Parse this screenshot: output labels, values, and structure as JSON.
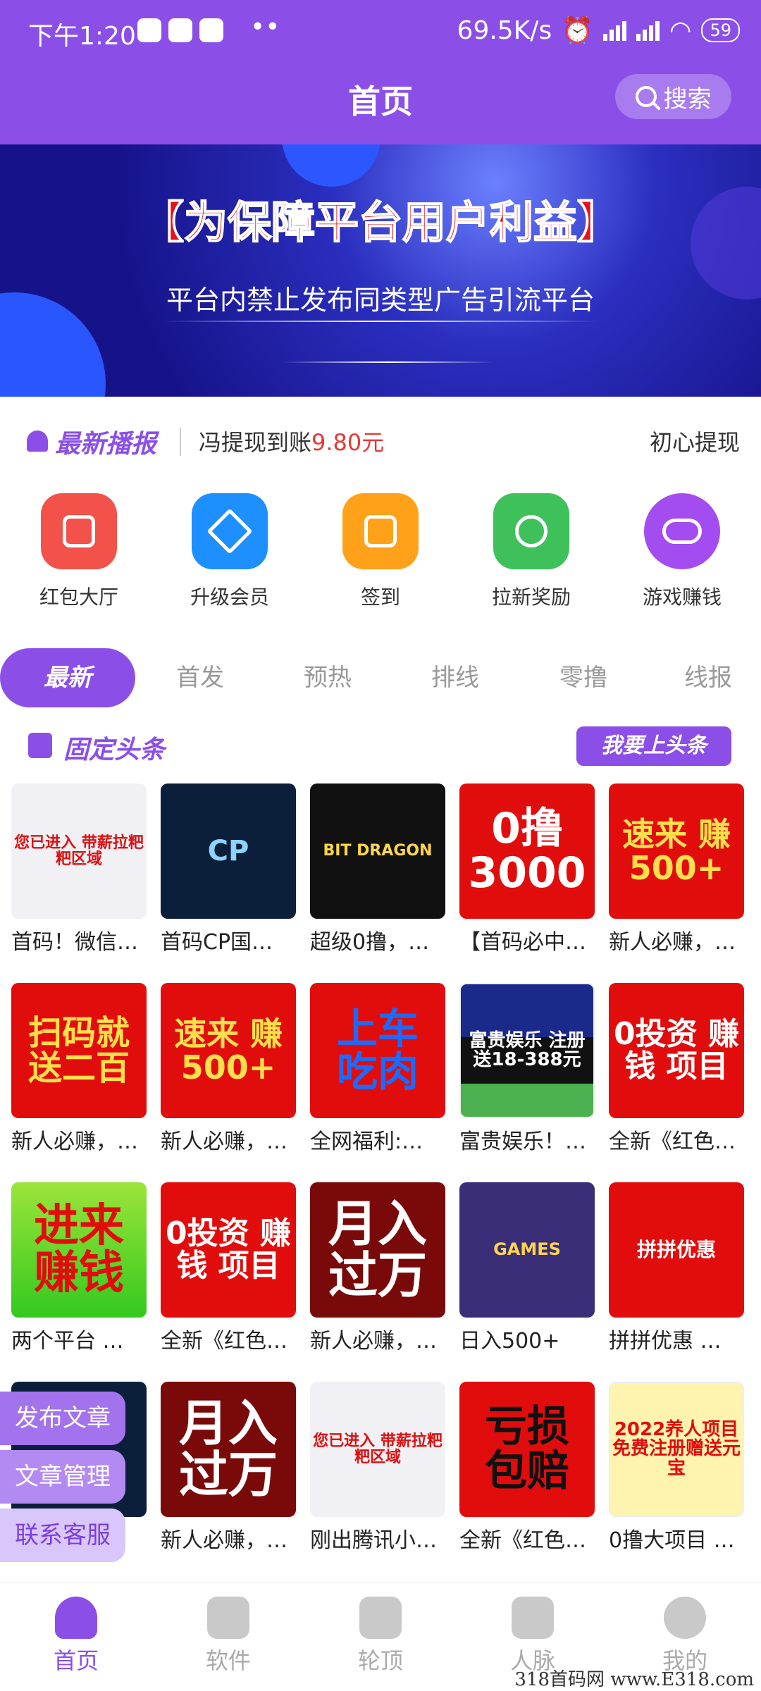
{
  "status": {
    "time": "下午1:20",
    "dots": "••",
    "network_speed": "69.5K/s",
    "battery": "59"
  },
  "header": {
    "title": "首页",
    "search_label": "搜索"
  },
  "banner": {
    "title": "【为保障平台用户利益】",
    "subtitle": "平台内禁止发布同类型广告引流平台"
  },
  "ticker": {
    "tag": "最新播报",
    "message_prefix": "冯提现到账",
    "message_amount": "9.80元",
    "message_next": "初心提现"
  },
  "quick_icons": [
    {
      "label": "红包大厅",
      "color": "#F2524A"
    },
    {
      "label": "升级会员",
      "color": "#1E8FFF"
    },
    {
      "label": "签到",
      "color": "#FFA21A"
    },
    {
      "label": "拉新奖励",
      "color": "#3EC15B"
    },
    {
      "label": "游戏赚钱",
      "color": "#A34CF0"
    }
  ],
  "tabs": [
    "最新",
    "首发",
    "预热",
    "排线",
    "零撸",
    "线报"
  ],
  "section": {
    "title": "固定头条",
    "button": "我要上头条"
  },
  "cards": [
    [
      {
        "thumb": "您已进入 带薪拉粑粑区域",
        "caption": "首码！微信…"
      },
      {
        "thumb": "CP",
        "caption": "首码CP国…"
      },
      {
        "thumb": "BIT DRAGON",
        "caption": "超级0撸，…"
      },
      {
        "thumb": "0撸 3000",
        "caption": "【首码必中…"
      },
      {
        "thumb": "速来 赚500+",
        "caption": "新人必赚，…"
      }
    ],
    [
      {
        "thumb": "扫码就 送二百",
        "caption": "新人必赚，…"
      },
      {
        "thumb": "速来 赚500+",
        "caption": "新人必赚，…"
      },
      {
        "thumb": "上车 吃肉",
        "caption": "全网福利:…"
      },
      {
        "thumb": "富贵娱乐 注册送18-388元",
        "caption": "富贵娱乐！…"
      },
      {
        "thumb": "0投资 赚钱 项目",
        "caption": "全新《红色…"
      }
    ],
    [
      {
        "thumb": "进来 赚钱",
        "caption": "两个平台 …"
      },
      {
        "thumb": "0投资 赚钱 项目",
        "caption": "全新《红色…"
      },
      {
        "thumb": "月入 过万",
        "caption": "新人必赚，…"
      },
      {
        "thumb": "GAMES",
        "caption": "日入500+"
      },
      {
        "thumb": "拼拼优惠",
        "caption": "拼拼优惠 …"
      }
    ],
    [
      {
        "thumb": "",
        "caption": ""
      },
      {
        "thumb": "月入 过万",
        "caption": "新人必赚，…"
      },
      {
        "thumb": "您已进入 带薪拉粑粑区域",
        "caption": "刚出腾讯小…"
      },
      {
        "thumb": "亏损 包赔",
        "caption": "全新《红色…"
      },
      {
        "thumb": "2022养人项目 免费注册赠送元宝",
        "caption": "0撸大项目 …"
      }
    ]
  ],
  "side_buttons": [
    "发布文章",
    "文章管理",
    "联系客服"
  ],
  "bottom_nav": [
    "首页",
    "软件",
    "轮顶",
    "人脉",
    "我的"
  ],
  "watermark": "318首码网 www.E318.com"
}
